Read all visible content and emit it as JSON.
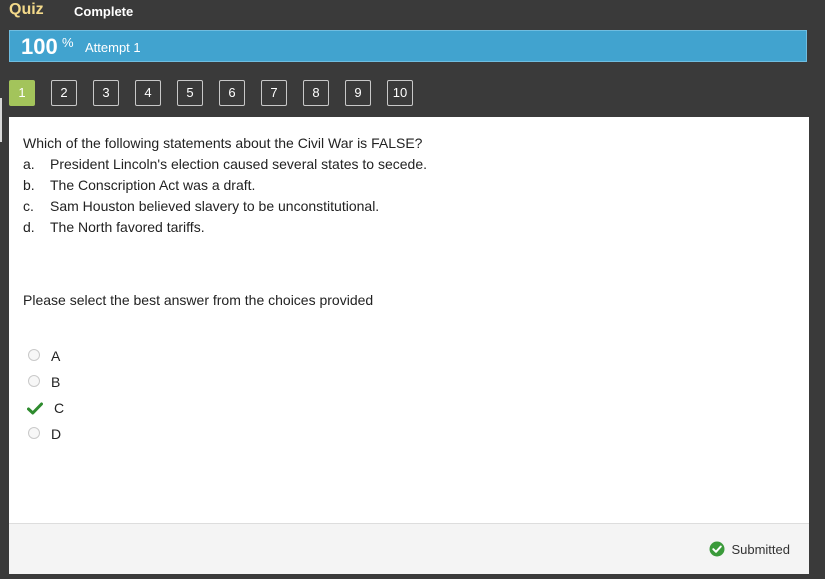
{
  "header": {
    "title": "Quiz",
    "status": "Complete"
  },
  "score": {
    "value": "100",
    "unit": "%",
    "attempt": "Attempt 1"
  },
  "nav": {
    "buttons": [
      "1",
      "2",
      "3",
      "4",
      "5",
      "6",
      "7",
      "8",
      "9",
      "10"
    ],
    "active": "1"
  },
  "question": {
    "text": "Which of the following statements about the Civil War is FALSE?",
    "choices": [
      {
        "letter": "a.",
        "text": "President Lincoln's election caused several states to secede."
      },
      {
        "letter": "b.",
        "text": "The Conscription Act was a draft."
      },
      {
        "letter": "c.",
        "text": "Sam Houston believed slavery to be unconstitutional."
      },
      {
        "letter": "d.",
        "text": "The North favored tariffs."
      }
    ],
    "instruction": "Please select the best answer from the choices provided"
  },
  "answers": [
    {
      "label": "A",
      "checked": false
    },
    {
      "label": "B",
      "checked": false
    },
    {
      "label": "C",
      "checked": true
    },
    {
      "label": "D",
      "checked": false
    }
  ],
  "footer": {
    "status": "Submitted"
  },
  "colors": {
    "accent_blue": "#41a3cf",
    "active_green": "#a3c45b",
    "check_green": "#2e8b2e",
    "title_yellow": "#f3d98a"
  },
  "icons": {
    "correct": "check-icon",
    "submitted": "check-circle-icon"
  }
}
